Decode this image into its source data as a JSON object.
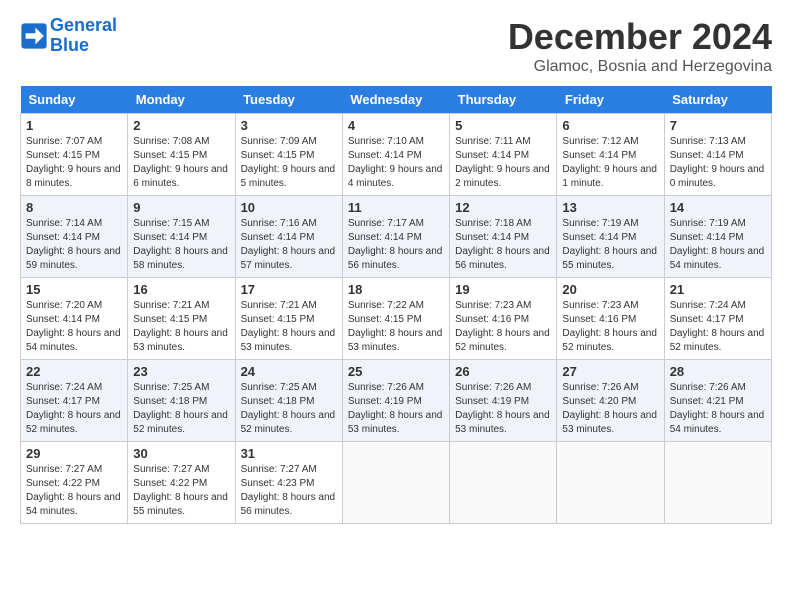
{
  "logo": {
    "line1": "General",
    "line2": "Blue"
  },
  "title": "December 2024",
  "location": "Glamoc, Bosnia and Herzegovina",
  "header": {
    "accent_color": "#2a7de1"
  },
  "days_of_week": [
    "Sunday",
    "Monday",
    "Tuesday",
    "Wednesday",
    "Thursday",
    "Friday",
    "Saturday"
  ],
  "weeks": [
    [
      {
        "num": "1",
        "sunrise": "Sunrise: 7:07 AM",
        "sunset": "Sunset: 4:15 PM",
        "daylight": "Daylight: 9 hours and 8 minutes."
      },
      {
        "num": "2",
        "sunrise": "Sunrise: 7:08 AM",
        "sunset": "Sunset: 4:15 PM",
        "daylight": "Daylight: 9 hours and 6 minutes."
      },
      {
        "num": "3",
        "sunrise": "Sunrise: 7:09 AM",
        "sunset": "Sunset: 4:15 PM",
        "daylight": "Daylight: 9 hours and 5 minutes."
      },
      {
        "num": "4",
        "sunrise": "Sunrise: 7:10 AM",
        "sunset": "Sunset: 4:14 PM",
        "daylight": "Daylight: 9 hours and 4 minutes."
      },
      {
        "num": "5",
        "sunrise": "Sunrise: 7:11 AM",
        "sunset": "Sunset: 4:14 PM",
        "daylight": "Daylight: 9 hours and 2 minutes."
      },
      {
        "num": "6",
        "sunrise": "Sunrise: 7:12 AM",
        "sunset": "Sunset: 4:14 PM",
        "daylight": "Daylight: 9 hours and 1 minute."
      },
      {
        "num": "7",
        "sunrise": "Sunrise: 7:13 AM",
        "sunset": "Sunset: 4:14 PM",
        "daylight": "Daylight: 9 hours and 0 minutes."
      }
    ],
    [
      {
        "num": "8",
        "sunrise": "Sunrise: 7:14 AM",
        "sunset": "Sunset: 4:14 PM",
        "daylight": "Daylight: 8 hours and 59 minutes."
      },
      {
        "num": "9",
        "sunrise": "Sunrise: 7:15 AM",
        "sunset": "Sunset: 4:14 PM",
        "daylight": "Daylight: 8 hours and 58 minutes."
      },
      {
        "num": "10",
        "sunrise": "Sunrise: 7:16 AM",
        "sunset": "Sunset: 4:14 PM",
        "daylight": "Daylight: 8 hours and 57 minutes."
      },
      {
        "num": "11",
        "sunrise": "Sunrise: 7:17 AM",
        "sunset": "Sunset: 4:14 PM",
        "daylight": "Daylight: 8 hours and 56 minutes."
      },
      {
        "num": "12",
        "sunrise": "Sunrise: 7:18 AM",
        "sunset": "Sunset: 4:14 PM",
        "daylight": "Daylight: 8 hours and 56 minutes."
      },
      {
        "num": "13",
        "sunrise": "Sunrise: 7:19 AM",
        "sunset": "Sunset: 4:14 PM",
        "daylight": "Daylight: 8 hours and 55 minutes."
      },
      {
        "num": "14",
        "sunrise": "Sunrise: 7:19 AM",
        "sunset": "Sunset: 4:14 PM",
        "daylight": "Daylight: 8 hours and 54 minutes."
      }
    ],
    [
      {
        "num": "15",
        "sunrise": "Sunrise: 7:20 AM",
        "sunset": "Sunset: 4:14 PM",
        "daylight": "Daylight: 8 hours and 54 minutes."
      },
      {
        "num": "16",
        "sunrise": "Sunrise: 7:21 AM",
        "sunset": "Sunset: 4:15 PM",
        "daylight": "Daylight: 8 hours and 53 minutes."
      },
      {
        "num": "17",
        "sunrise": "Sunrise: 7:21 AM",
        "sunset": "Sunset: 4:15 PM",
        "daylight": "Daylight: 8 hours and 53 minutes."
      },
      {
        "num": "18",
        "sunrise": "Sunrise: 7:22 AM",
        "sunset": "Sunset: 4:15 PM",
        "daylight": "Daylight: 8 hours and 53 minutes."
      },
      {
        "num": "19",
        "sunrise": "Sunrise: 7:23 AM",
        "sunset": "Sunset: 4:16 PM",
        "daylight": "Daylight: 8 hours and 52 minutes."
      },
      {
        "num": "20",
        "sunrise": "Sunrise: 7:23 AM",
        "sunset": "Sunset: 4:16 PM",
        "daylight": "Daylight: 8 hours and 52 minutes."
      },
      {
        "num": "21",
        "sunrise": "Sunrise: 7:24 AM",
        "sunset": "Sunset: 4:17 PM",
        "daylight": "Daylight: 8 hours and 52 minutes."
      }
    ],
    [
      {
        "num": "22",
        "sunrise": "Sunrise: 7:24 AM",
        "sunset": "Sunset: 4:17 PM",
        "daylight": "Daylight: 8 hours and 52 minutes."
      },
      {
        "num": "23",
        "sunrise": "Sunrise: 7:25 AM",
        "sunset": "Sunset: 4:18 PM",
        "daylight": "Daylight: 8 hours and 52 minutes."
      },
      {
        "num": "24",
        "sunrise": "Sunrise: 7:25 AM",
        "sunset": "Sunset: 4:18 PM",
        "daylight": "Daylight: 8 hours and 52 minutes."
      },
      {
        "num": "25",
        "sunrise": "Sunrise: 7:26 AM",
        "sunset": "Sunset: 4:19 PM",
        "daylight": "Daylight: 8 hours and 53 minutes."
      },
      {
        "num": "26",
        "sunrise": "Sunrise: 7:26 AM",
        "sunset": "Sunset: 4:19 PM",
        "daylight": "Daylight: 8 hours and 53 minutes."
      },
      {
        "num": "27",
        "sunrise": "Sunrise: 7:26 AM",
        "sunset": "Sunset: 4:20 PM",
        "daylight": "Daylight: 8 hours and 53 minutes."
      },
      {
        "num": "28",
        "sunrise": "Sunrise: 7:26 AM",
        "sunset": "Sunset: 4:21 PM",
        "daylight": "Daylight: 8 hours and 54 minutes."
      }
    ],
    [
      {
        "num": "29",
        "sunrise": "Sunrise: 7:27 AM",
        "sunset": "Sunset: 4:22 PM",
        "daylight": "Daylight: 8 hours and 54 minutes."
      },
      {
        "num": "30",
        "sunrise": "Sunrise: 7:27 AM",
        "sunset": "Sunset: 4:22 PM",
        "daylight": "Daylight: 8 hours and 55 minutes."
      },
      {
        "num": "31",
        "sunrise": "Sunrise: 7:27 AM",
        "sunset": "Sunset: 4:23 PM",
        "daylight": "Daylight: 8 hours and 56 minutes."
      },
      null,
      null,
      null,
      null
    ]
  ]
}
